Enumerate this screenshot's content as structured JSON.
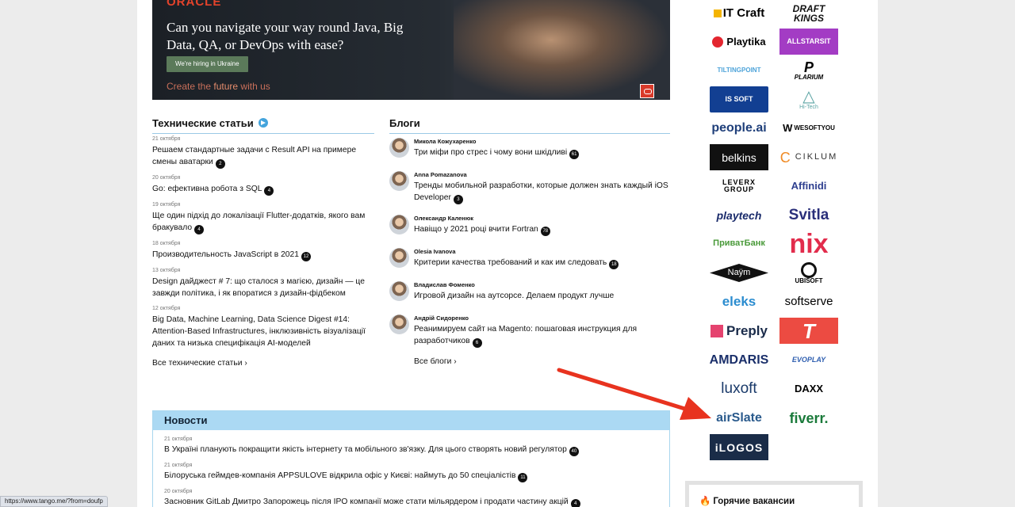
{
  "banner": {
    "brand": "ORACLE",
    "headline": "Can you navigate your way round Java, Big Data, QA, or DevOps with ease?",
    "button": "We're hiring in Ukraine",
    "tagline_prefix": "Create the ",
    "tagline_em": "future",
    "tagline_suffix": " with us"
  },
  "tech_articles": {
    "heading": "Технические статьи",
    "items": [
      {
        "date": "21 октября",
        "title": "Решаем стандартные задачи с Result API на примере смены аватарки",
        "comments": "2"
      },
      {
        "date": "20 октября",
        "title": "Go: ефективна робота з SQL",
        "comments": "4"
      },
      {
        "date": "19 октября",
        "title": "Ще один підхід до локалізації Flutter-додатків, якого вам бракувало",
        "comments": "4"
      },
      {
        "date": "18 октября",
        "title": "Производительность JavaScript в 2021",
        "comments": "12"
      },
      {
        "date": "13 октября",
        "title": "Design дайджест # 7: що сталося з магією, дизайн — це завжди політика, і як впоратися з дизайн-фідбеком",
        "comments": ""
      },
      {
        "date": "12 октября",
        "title": "Big Data, Machine Learning, Data Science Digest #14: Attention-Based Infrastructures, інклюзивність візуалізації даних та низька специфікація AI-моделей",
        "comments": ""
      }
    ],
    "all_link": "Все технические статьи"
  },
  "blogs": {
    "heading": "Блоги",
    "items": [
      {
        "author": "Микола Кожухаренко",
        "title": "Три міфи про стрес і чому вони шкідливі",
        "comments": "61"
      },
      {
        "author": "Anna Pomazanova",
        "title": "Тренды мобильной разработки, которые должен знать каждый iOS Developer",
        "comments": "3"
      },
      {
        "author": "Олександр Каленюк",
        "title": "Навіщо у 2021 році вчити Fortran",
        "comments": "78"
      },
      {
        "author": "Olesia Ivanova",
        "title": "Критерии качества требований и как им следовать",
        "comments": "18"
      },
      {
        "author": "Владислав Фоменко",
        "title": "Игровой дизайн на аутсорсе. Делаем продукт лучше",
        "comments": ""
      },
      {
        "author": "Андрій Сидоренко",
        "title": "Реанимируем сайт на Magento: пошаговая инструкция для разработчиков",
        "comments": "6"
      }
    ],
    "all_link": "Все блоги"
  },
  "news": {
    "heading": "Новости",
    "items": [
      {
        "date": "21 октября",
        "title": "В Україні планують покращити якість інтернету та мобільного зв'язку. Для цього створять новий регулятор",
        "comments": "40"
      },
      {
        "date": "21 октября",
        "title": "Білоруська геймдев-компанія APPSULOVE відкрила офіс у Києві: наймуть до 50 спеціалістів",
        "comments": "11"
      },
      {
        "date": "20 октября",
        "title": "Засновник GitLab Дмитро Запорожець після IPO компанії може стати мільярдером і продати частину акцій",
        "comments": "4"
      }
    ]
  },
  "logos": [
    {
      "name": "itcraft",
      "text": "IT Craft",
      "color": "#1a1a1a"
    },
    {
      "name": "draftkings",
      "text": "DRAFT KINGS",
      "color": "#1a1a1a"
    },
    {
      "name": "playtika",
      "text": "Playtika",
      "color": "#111"
    },
    {
      "name": "allstarsit",
      "text": "ALLSTARSIT",
      "color": "#ffffff"
    },
    {
      "name": "tiltingpoint",
      "text": "TILTINGPOINT",
      "color": "#4da3d9"
    },
    {
      "name": "plarium",
      "text": "PLARIUM",
      "color": "#111"
    },
    {
      "name": "issoft",
      "text": "IS SOFT",
      "color": "#ffffff"
    },
    {
      "name": "hitech",
      "text": "Hi-Tech",
      "color": "#5aa3a3"
    },
    {
      "name": "peopleai",
      "text": "people.ai",
      "color": "#1f3f7a"
    },
    {
      "name": "wesoftyou",
      "text": "WESOFTYOU",
      "color": "#111"
    },
    {
      "name": "belkins",
      "text": "belkins",
      "color": "#ffffff"
    },
    {
      "name": "ciklum",
      "text": "CIKLUM",
      "color": "#333"
    },
    {
      "name": "leverx",
      "text": "LEVERX GROUP",
      "color": "#1a1a1a"
    },
    {
      "name": "affinidi",
      "text": "Affinidi",
      "color": "#2e3f8f"
    },
    {
      "name": "playtech",
      "text": "playtech",
      "color": "#1a2b6b"
    },
    {
      "name": "svitla",
      "text": "Svitla",
      "color": "#2a2f7a"
    },
    {
      "name": "privatbank",
      "text": "ПриватБанк",
      "color": "#4a9a3a"
    },
    {
      "name": "nix",
      "text": "nix",
      "color": "#e22c4c"
    },
    {
      "name": "naym",
      "text": "Naÿm",
      "color": "#ffffff"
    },
    {
      "name": "ubisoft",
      "text": "UBISOFT",
      "color": "#111"
    },
    {
      "name": "eleks",
      "text": "eleks",
      "color": "#2b8ccf"
    },
    {
      "name": "softserve",
      "text": "softserve",
      "color": "#1a1a1a"
    },
    {
      "name": "preply",
      "text": "Preply",
      "color": "#1a2b4a"
    },
    {
      "name": "tlogo",
      "text": "T",
      "color": "#ffffff"
    },
    {
      "name": "amdaris",
      "text": "AMDARIS",
      "color": "#1a2f6a"
    },
    {
      "name": "evoplay",
      "text": "EVOPLAY",
      "color": "#2f5fb0"
    },
    {
      "name": "luxoft",
      "text": "luxoft",
      "color": "#1a3a6a"
    },
    {
      "name": "daxx",
      "text": "DAXX",
      "color": "#111"
    },
    {
      "name": "airslate",
      "text": "airSlate",
      "color": "#2a5a8c"
    },
    {
      "name": "fiverr",
      "text": "fiverr.",
      "color": "#1a7a3a"
    },
    {
      "name": "ilogos",
      "text": "iLOGOS",
      "color": "#ffffff"
    }
  ],
  "hot_vacancies": {
    "label": "Горячие вакансии"
  },
  "status_bar": {
    "url": "https://www.tango.me/?from=doufp"
  }
}
